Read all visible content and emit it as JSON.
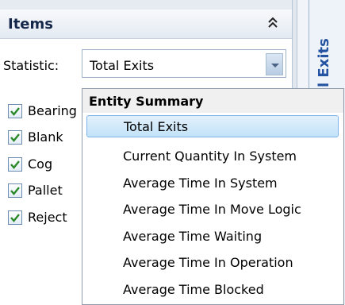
{
  "panel": {
    "title": "Items",
    "statistic_label": "Statistic:",
    "statistic_value": "Total Exits",
    "items": [
      {
        "label": "Bearing",
        "checked": true
      },
      {
        "label": "Blank",
        "checked": true
      },
      {
        "label": "Cog",
        "checked": true
      },
      {
        "label": "Pallet",
        "checked": true
      },
      {
        "label": "Reject",
        "checked": true
      }
    ]
  },
  "side_tab": {
    "label": "l Exits"
  },
  "dropdown": {
    "group_header": "Entity Summary",
    "options": [
      {
        "label": "Total Exits",
        "selected": true
      },
      {
        "label": "Current Quantity In System"
      },
      {
        "label": "Average Time In System"
      },
      {
        "label": "Average Time In Move Logic"
      },
      {
        "label": "Average Time Waiting"
      },
      {
        "label": "Average Time In Operation"
      },
      {
        "label": "Average Time Blocked"
      }
    ]
  },
  "colors": {
    "accent": "#2453a1",
    "selection": "#c2e2f8",
    "check": "#2a8a2a"
  },
  "icons": {
    "collapse": "double-chevron-up-icon",
    "dropdown": "chevron-down-icon",
    "checkbox": "checkmark-icon"
  }
}
